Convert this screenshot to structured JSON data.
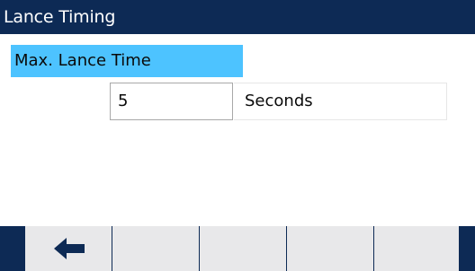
{
  "title": "Lance Timing",
  "field": {
    "label": "Max. Lance Time",
    "value": "5",
    "unit": "Seconds"
  },
  "softkeys": [
    {
      "icon": "arrow-left-icon"
    },
    {
      "icon": ""
    },
    {
      "icon": ""
    },
    {
      "icon": ""
    },
    {
      "icon": ""
    }
  ],
  "colors": {
    "title_bar": "#0d2a55",
    "highlight": "#4dc3ff",
    "softkey": "#e8e8ea"
  }
}
